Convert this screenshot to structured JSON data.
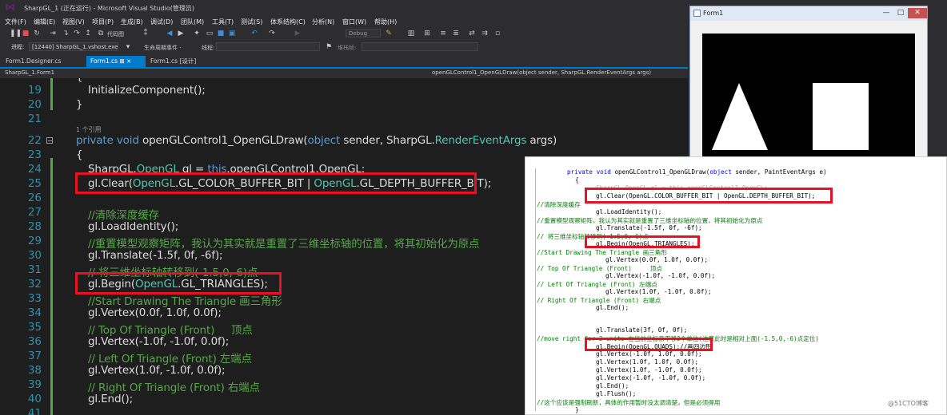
{
  "window": {
    "title": "SharpGL_1 (正在运行) - Microsoft Visual Studio(管理员)"
  },
  "menu": [
    "文件(F)",
    "编辑(E)",
    "视图(V)",
    "项目(P)",
    "生成(B)",
    "调试(D)",
    "团队(M)",
    "工具(T)",
    "测试(S)",
    "体系结构(C)",
    "分析(N)",
    "窗口(W)",
    "帮助(H)"
  ],
  "toolbar": {
    "code_map": "代码图",
    "config": "Debug",
    "process_label": "进程:",
    "process_value": "[12440] SharpGL_1.vshost.exe",
    "lifecycle_label": "生命周期事件 ·",
    "thread_label": "线程:",
    "stack_label": "堆栈帧:"
  },
  "tabs": [
    {
      "label": "Form1.Designer.cs",
      "active": false
    },
    {
      "label": "Form1.cs ⊠ ×",
      "active": true
    },
    {
      "label": "Form1.cs [设计]",
      "active": false
    }
  ],
  "navbar": {
    "left": "SharpGL_1.Form1",
    "right": "openGLControl1_OpenGLDraw(object sender, SharpGL.RenderEventArgs args)"
  },
  "editor": {
    "ref_count": "1 个引用",
    "line_numbers": [
      "19",
      "20",
      "21",
      "22",
      "23",
      "24",
      "25",
      "26",
      "27",
      "28",
      "29",
      "30",
      "31",
      "32",
      "33",
      "34",
      "35",
      "36",
      "37",
      "38",
      "39",
      "40",
      "41"
    ],
    "lines": {
      "l18": "{",
      "l19": "InitializeComponent();",
      "l20": "}",
      "l22_kw1": "private",
      "l22_kw2": "void",
      "l22_name": "openGLControl1_OpenGLDraw(",
      "l22_kw3": "object",
      "l22_sender": " sender, SharpGL.",
      "l22_type": "RenderEventArgs",
      "l22_args": " args)",
      "l23": "{",
      "l24_a": "SharpGL.",
      "l24_type": "OpenGL",
      "l24_b": " gl = ",
      "l24_kw": "this",
      "l24_c": ".openGLControl1.OpenGL;",
      "l25_a": "gl.Clear(",
      "l25_t1": "OpenGL",
      "l25_b": ".GL_COLOR_BUFFER_BIT | ",
      "l25_t2": "OpenGL",
      "l25_c": ".GL_DEPTH_BUFFER_BIT);",
      "l27": "//清除深度缓存",
      "l28": "gl.LoadIdentity();",
      "l29": "//重置模型观察矩阵，我认为其实就是重置了三维坐标轴的位置，将其初始化为原点",
      "l30": "gl.Translate(-1.5f, 0f, -6f);",
      "l31": "// 将三维坐标轴转移到(-1.5,0,-6)点",
      "l32_a": "gl.Begin(",
      "l32_type": "OpenGL",
      "l32_b": ".GL_TRIANGLES);",
      "l33": "//Start Drawing The Triangle 画三角形",
      "l34": "gl.Vertex(0.0f, 1.0f, 0.0f);",
      "l35": "// Top Of Triangle (Front)     顶点",
      "l36": "gl.Vertex(-1.0f, -1.0f, 0.0f);",
      "l37": "// Left Of Triangle (Front) 左端点",
      "l38": "gl.Vertex(1.0f, -1.0f, 0.0f);",
      "l39": "// Right Of Triangle (Front) 右端点",
      "l40": "gl.End();"
    }
  },
  "form1": {
    "title": "Form1",
    "minimize": "—",
    "restore": "□",
    "close": "✕"
  },
  "snippet": {
    "lines": [
      "private void openGLControl1_OpenGLDraw(object sender, PaintEventArgs e)",
      "{",
      "SharpGL.OpenGL gl = this.openGLControl1.OpenGL;",
      "gl.Clear(OpenGL.COLOR_BUFFER_BIT | OpenGL.DEPTH_BUFFER_BIT);",
      "//清除深度缓存",
      "gl.LoadIdentity();",
      "//重置模型观察矩阵，我认为其实就是重置了三维坐标轴的位置，将其初始化为原点",
      "gl.Translate(-1.5f, 0f, -6f);",
      "// 将三维坐标轴转移到(-1.5,0,-6)点",
      "gl.Begin(OpenGL.TRIANGLES);",
      "//Start Drawing The Triangle 画三角形",
      "gl.Vertex(0.0f, 1.0f, 0.0f);",
      "// Top Of Triangle (Front)     顶点",
      "gl.Vertex(-1.0f, -1.0f, 0.0f);",
      "// Left Of Triangle (Front) 左端点",
      "gl.Vertex(1.0f, -1.0f, 0.0f);",
      "// Right Of Triangle (Front) 右端点",
      "gl.End();",
      "gl.Translate(3f, 0f, 0f);",
      "//move right for 3 units 在当前坐标系下移3个单位(注意此时是相对上面(-1.5,0,-6)点定位)",
      "gl.Begin(OpenGL.QUADS);//画四边形",
      "gl.Vertex(-1.0f, 1.0f, 0.0f);",
      "gl.Vertex(1.0f, 1.0f, 0.0f);",
      "gl.Vertex(1.0f, -1.0f, 0.0f);",
      "gl.Vertex(-1.0f, -1.0f, 0.0f);",
      "gl.End();",
      "gl.Flush();",
      "//这个应该是强制刷新，具体的作用暂时没太调清楚，但是必须得用",
      "}"
    ]
  },
  "watermark": "@51CTO博客",
  "colors": {
    "accent": "#007acc",
    "highlight_box": "#e81123",
    "editor_bg": "#1e1e1e"
  }
}
